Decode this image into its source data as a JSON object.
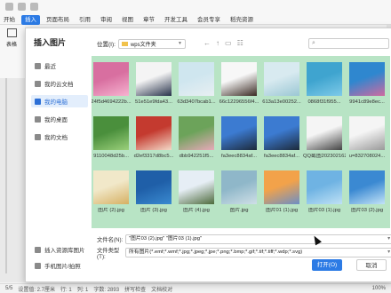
{
  "app": {
    "menu": [
      "开始",
      "插入",
      "页面布局",
      "引用",
      "审阅",
      "视图",
      "章节",
      "开发工具",
      "会员专享",
      "稻壳资源"
    ],
    "active_menu": "插入",
    "left_labels": [
      "表格"
    ],
    "statusbar": [
      "5/5",
      "设置值: 2.7厘米",
      "行: 1",
      "列: 1",
      "字数: 2893",
      "拼写检查",
      "文档校对",
      "100%"
    ]
  },
  "dialog": {
    "title": "插入图片",
    "sidebar": [
      {
        "label": "最近",
        "icon": "clock-icon"
      },
      {
        "label": "我的云文档",
        "icon": "cloud-icon"
      },
      {
        "label": "我的电脑",
        "icon": "computer-icon",
        "selected": true
      },
      {
        "label": "我的桌面",
        "icon": "desktop-icon"
      },
      {
        "label": "我的文档",
        "icon": "document-icon"
      }
    ],
    "sidebar_bottom": [
      {
        "label": "插入资源库图片",
        "icon": "image-library-icon"
      },
      {
        "label": "手机图片/拍照",
        "icon": "phone-icon"
      }
    ],
    "location_label": "位置(I):",
    "location_value": "wps文件夹",
    "files": [
      {
        "name": "24f5d4694222b...",
        "color": "#d86fa0",
        "color2": "#f6b3d0"
      },
      {
        "name": "51e51e9fda43...",
        "color": "#f4f4f4",
        "color2": "#27324a"
      },
      {
        "name": "63d3407bcab1...",
        "color": "#cfe6ef",
        "color2": "#e8eff2"
      },
      {
        "name": "66c12296556f4...",
        "color": "#f7f7f7",
        "color2": "#3a2a22"
      },
      {
        "name": "613a13e00252...",
        "color": "#d8eaf0",
        "color2": "#9bc7d4"
      },
      {
        "name": "0868f31f955...",
        "color": "#3fa4cf",
        "color2": "#7ecae8"
      },
      {
        "name": "9941c89e8ec...",
        "color": "#2f87cf",
        "color2": "#d06aa0"
      },
      {
        "name": "9110048d25b...",
        "color": "#4a8f3c",
        "color2": "#9bd07b"
      },
      {
        "name": "d2ef3317d8bc5...",
        "color": "#c43a2f",
        "color2": "#f3d9c8"
      },
      {
        "name": "dbb942251f5...",
        "color": "#6ca35a",
        "color2": "#e7a9b9"
      },
      {
        "name": "fa3eec8834af...",
        "color": "#3c7bd1",
        "color2": "#1d2a3a"
      },
      {
        "name": "fa3eec8834af...",
        "color": "#3c7bd1",
        "color2": "#1d2a3a"
      },
      {
        "name": "QQ截图20230216211...",
        "color": "#f5f5f5",
        "color2": "#444444"
      },
      {
        "name": "u=832708024...",
        "color": "#f5f5f5",
        "color2": "#999999"
      },
      {
        "name": "图片 (2).jpg",
        "color": "#f1e8c9",
        "color2": "#d6b063"
      },
      {
        "name": "图片 (3).jpg",
        "color": "#1f5fa8",
        "color2": "#3a8ad0"
      },
      {
        "name": "图片 (4).jpg",
        "color": "#e6eef5",
        "color2": "#4d6a3c"
      },
      {
        "name": "图片.jpg",
        "color": "#8fb7c9",
        "color2": "#cfdfe6"
      },
      {
        "name": "图片01 (1).jpg",
        "color": "#f2a24a",
        "color2": "#6c8fc6"
      },
      {
        "name": "图片03 (1).jpg",
        "color": "#6fb3e3",
        "color2": "#bfe1f5"
      },
      {
        "name": "图片03 (2).jpg",
        "color": "#3b89d2",
        "color2": "#c3e3f7"
      }
    ],
    "filename_label": "文件名(N):",
    "filename_value": "\"图片03 (2).jpg\" \"图片03 (1).jpg\"",
    "filetype_label": "文件类型(T):",
    "filetype_value": "所有图片(*.emf;*.wmf;*.jpg;*.jpeg;*.jpe;*.png;*.bmp;*.gif;*.tif;*.tiff;*.wdp;*.svg)",
    "open_button": "打开(O)",
    "cancel_button": "取消"
  }
}
